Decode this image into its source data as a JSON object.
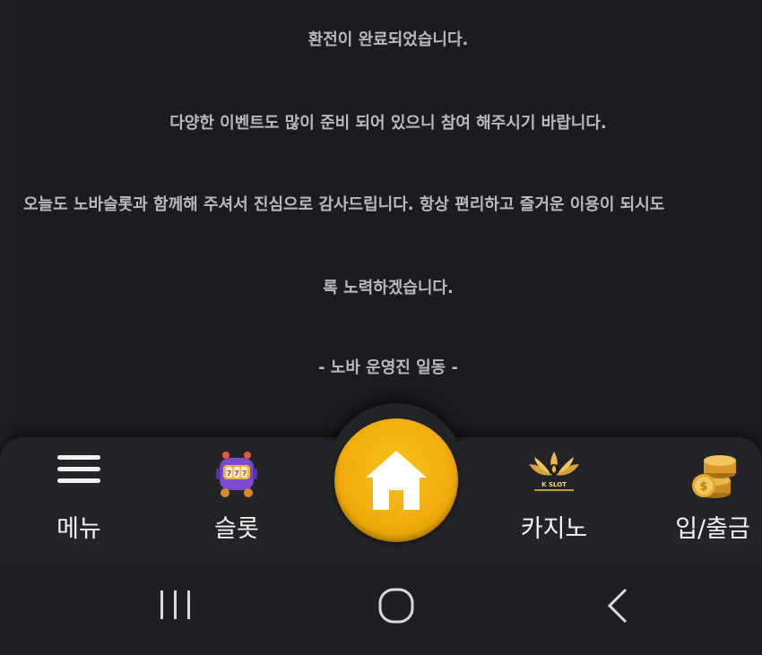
{
  "notice": {
    "lines": [
      "환전이 완료되었습니다.",
      "다양한 이벤트도 많이 준비 되어 있으니 참여 해주시기 바랍니다.",
      "오늘도 노바슬롯과 함께해 주셔서 진심으로 감사드립니다. 항상 편리하고 즐거운 이용이 되시도",
      "록 노력하겠습니다.",
      "- 노바 운영진 일동 -"
    ]
  },
  "bottom_nav": {
    "menu_label": "메뉴",
    "slot_label": "슬롯",
    "casino_label": "카지노",
    "casino_logo_text": "K SLOT",
    "bank_label": "입/출금",
    "home_icon": "home-icon"
  },
  "system_bar": {
    "recents_icon": "recents-icon",
    "home_icon": "circle-home-icon",
    "back_icon": "back-chevron-icon"
  },
  "colors": {
    "accent": "#f0ab0a",
    "text": "#b9babc",
    "nav_bg": "#232428"
  }
}
